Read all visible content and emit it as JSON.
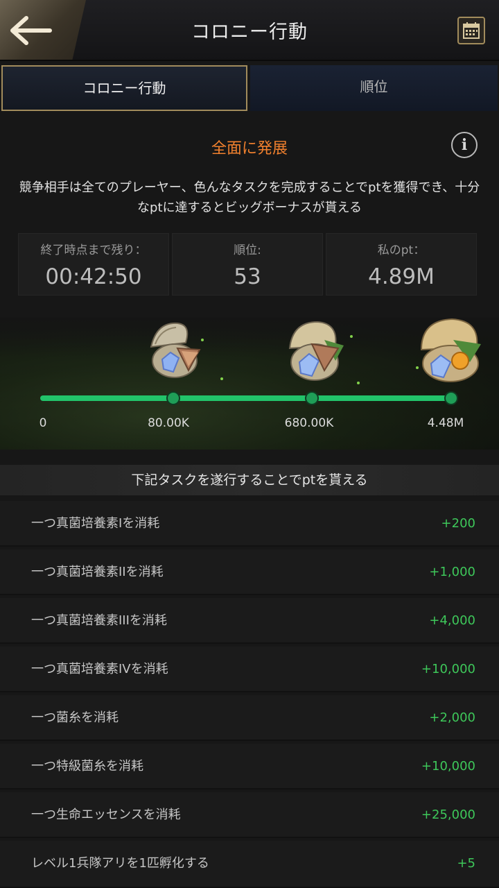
{
  "header": {
    "title": "コロニー行動",
    "back_icon": "arrow-left-icon",
    "calendar_icon": "calendar-icon"
  },
  "tabs": [
    {
      "label": "コロニー行動",
      "active": true
    },
    {
      "label": "順位",
      "active": false
    }
  ],
  "info": {
    "title": "全面に発展",
    "description": "競争相手は全てのプレーヤー、色んなタスクを完成することでptを獲得でき、十分なptに達するとビッグボーナスが貰える",
    "info_icon": "i"
  },
  "stats": [
    {
      "label": "終了時点まで残り：",
      "value": "00:42:50"
    },
    {
      "label": "順位:",
      "value": "53"
    },
    {
      "label": "私のpt：",
      "value": "4.89M"
    }
  ],
  "progress": {
    "fill_fraction": 1.0,
    "milestones": [
      "0",
      "80.00K",
      "680.00K",
      "4.48M"
    ],
    "reward_icons": [
      "shell-chest-small-icon",
      "shell-chest-medium-icon",
      "shell-chest-large-icon"
    ]
  },
  "tasks_header": "下記タスクを遂行することでptを貰える",
  "tasks": [
    {
      "name": "一つ真菌培養素Iを消耗",
      "points": "+200"
    },
    {
      "name": "一つ真菌培養素IIを消耗",
      "points": "+1,000"
    },
    {
      "name": "一つ真菌培養素IIIを消耗",
      "points": "+4,000"
    },
    {
      "name": "一つ真菌培養素IVを消耗",
      "points": "+10,000"
    },
    {
      "name": "一つ菌糸を消耗",
      "points": "+2,000"
    },
    {
      "name": "一つ特級菌糸を消耗",
      "points": "+10,000"
    },
    {
      "name": "一つ生命エッセンスを消耗",
      "points": "+25,000"
    },
    {
      "name": "レベル1兵隊アリを1匹孵化する",
      "points": "+5"
    }
  ],
  "colors": {
    "accent": "#f0802e",
    "progress": "#22c36a",
    "points": "#3ec85a",
    "gold_border": "#a28c5c"
  }
}
